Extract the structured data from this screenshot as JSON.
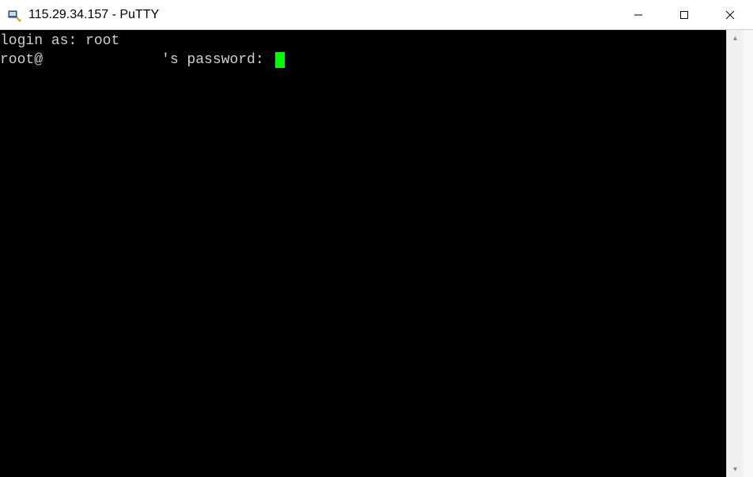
{
  "window": {
    "title": "115.29.34.157 - PuTTY",
    "app_name": "PuTTY",
    "host": "115.29.34.157"
  },
  "terminal": {
    "lines": {
      "login_prompt": "login as: ",
      "login_user": "root",
      "user_prefix": "root@",
      "password_prompt": "'s password: "
    },
    "cursor_color": "#00ff00",
    "bg_color": "#000000",
    "fg_color": "#d0d0d0"
  },
  "controls": {
    "minimize": "—",
    "maximize": "☐",
    "close": "✕"
  },
  "scrollbar": {
    "up": "▴",
    "down": "▾"
  }
}
